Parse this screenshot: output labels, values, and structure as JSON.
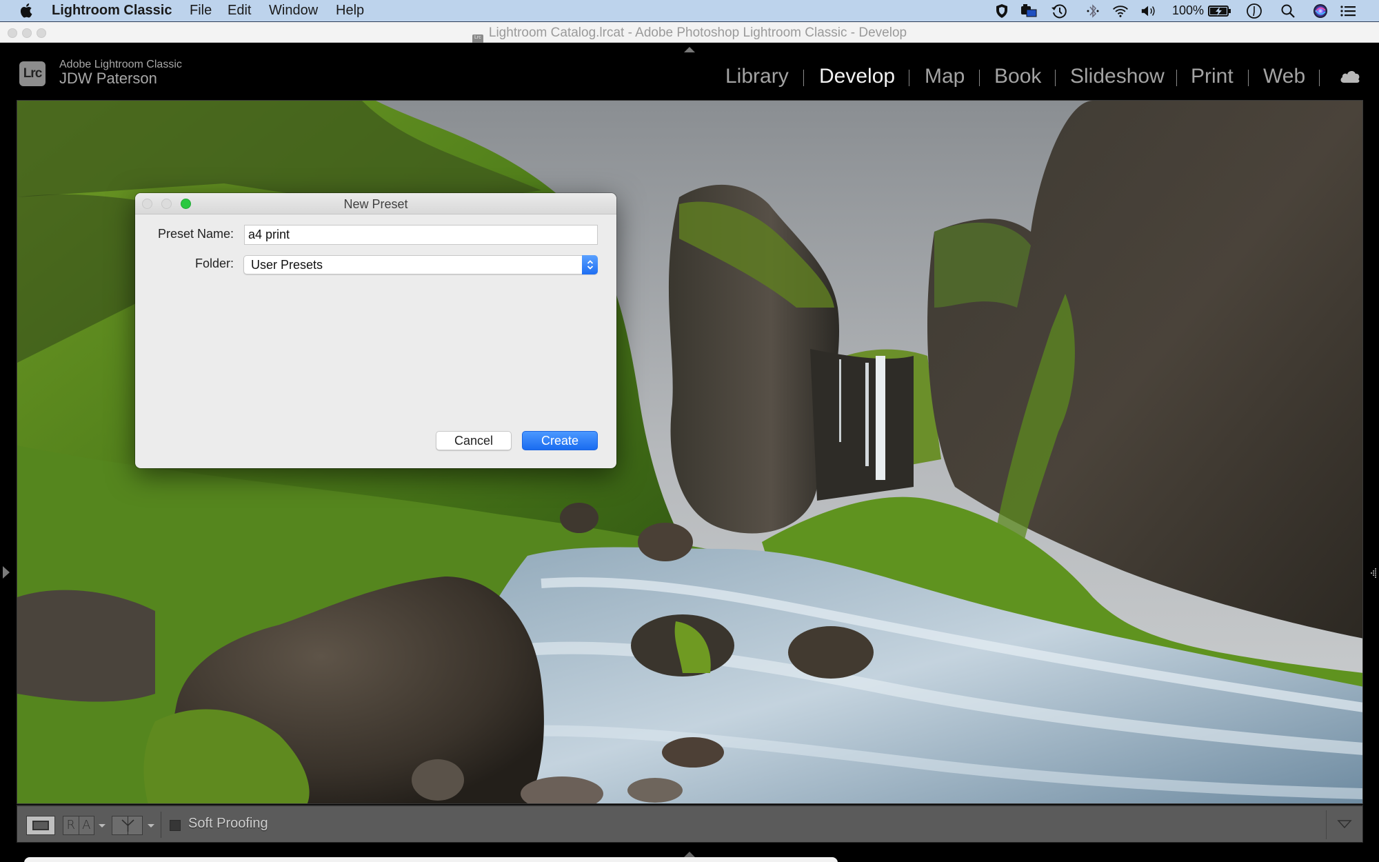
{
  "menubar": {
    "app_name": "Lightroom Classic",
    "items": [
      "File",
      "Edit",
      "Window",
      "Help"
    ],
    "status_icons": [
      "shield-icon",
      "camera-monitor-icon",
      "time-machine-icon",
      "bluetooth-icon",
      "wifi-icon",
      "volume-icon",
      "battery-icon",
      "accessibility-icon",
      "spotlight-search-icon",
      "siri-icon",
      "notification-center-icon"
    ],
    "battery_percent": "100%"
  },
  "window": {
    "title": "Lightroom Catalog.lrcat - Adobe Photoshop Lightroom Classic - Develop",
    "doc_icon_label": "Lrc"
  },
  "identity": {
    "badge": "Lrc",
    "product": "Adobe Lightroom Classic",
    "user": "JDW Paterson"
  },
  "modules": {
    "items": [
      {
        "label": "Library",
        "active": false
      },
      {
        "label": "Develop",
        "active": true
      },
      {
        "label": "Map",
        "active": false
      },
      {
        "label": "Book",
        "active": false
      },
      {
        "label": "Slideshow",
        "active": false
      },
      {
        "label": "Print",
        "active": false
      },
      {
        "label": "Web",
        "active": false
      }
    ],
    "cloud_icon": "cloud-icon"
  },
  "dialog": {
    "title": "New Preset",
    "preset_name_label": "Preset Name:",
    "preset_name_value": "a4 print",
    "folder_label": "Folder:",
    "folder_value": "User Presets",
    "cancel_label": "Cancel",
    "create_label": "Create"
  },
  "toolbar": {
    "loupe_view": "loupe-view-icon",
    "before_after_left": "R",
    "before_after_right": "A",
    "before_after_split": "before-after-split-icon",
    "soft_proofing_label": "Soft Proofing",
    "soft_proofing_checked": false
  },
  "colors": {
    "accent_blue": "#1a6cf0",
    "menubar_bg": "#bdd3ec",
    "dialog_bg": "#ececec",
    "zoom_green": "#2ac840",
    "toolbar_bg": "#5b5b5b",
    "active_module": "#f2f2f2",
    "inactive_module": "#a3a3a3"
  }
}
